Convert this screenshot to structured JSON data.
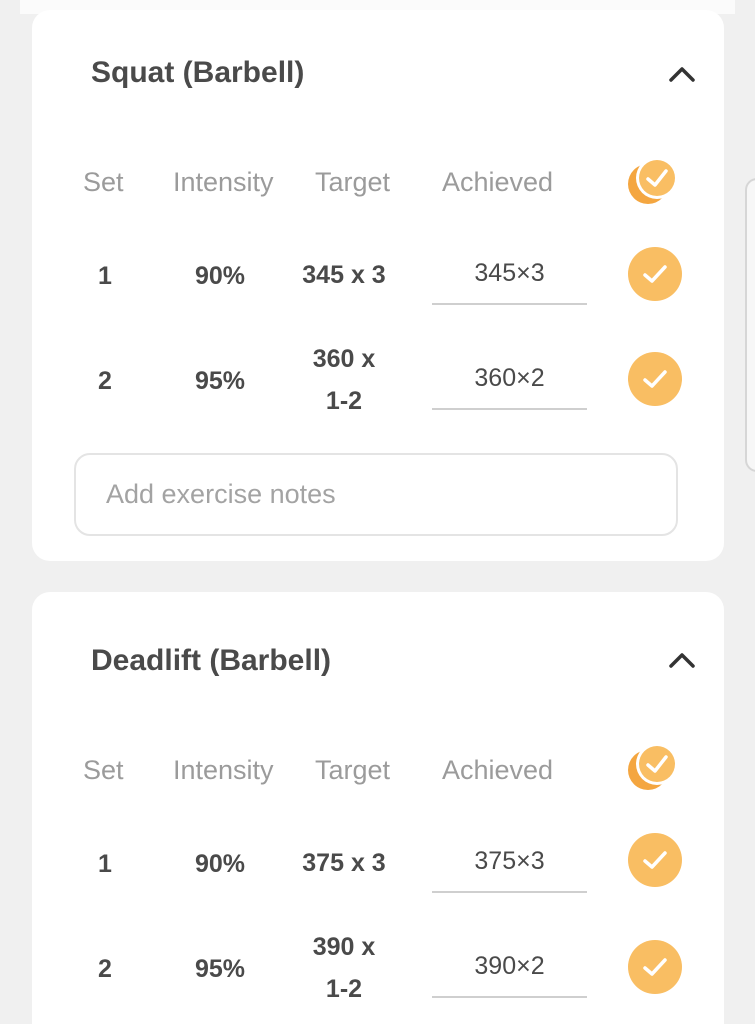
{
  "columns": {
    "set": "Set",
    "intensity": "Intensity",
    "target": "Target",
    "achieved": "Achieved"
  },
  "exercises": [
    {
      "name": "Squat (Barbell)",
      "sets": [
        {
          "set": "1",
          "intensity": "90%",
          "target_line1": "345 x 3",
          "target_line2": "",
          "achieved": "345×3",
          "completed": true
        },
        {
          "set": "2",
          "intensity": "95%",
          "target_line1": "360 x",
          "target_line2": "1-2",
          "achieved": "360×2",
          "completed": true
        }
      ],
      "notes_placeholder": "Add exercise notes"
    },
    {
      "name": "Deadlift (Barbell)",
      "sets": [
        {
          "set": "1",
          "intensity": "90%",
          "target_line1": "375 x 3",
          "target_line2": "",
          "achieved": "375×3",
          "completed": true
        },
        {
          "set": "2",
          "intensity": "95%",
          "target_line1": "390 x",
          "target_line2": "1-2",
          "achieved": "390×2",
          "completed": true
        }
      ]
    }
  ],
  "colors": {
    "accent": "#f9be63",
    "accent_dark": "#f4a640",
    "text": "#4a4a4a",
    "muted": "#9b9b9b"
  },
  "icons": {
    "collapse": "chevron-up-icon",
    "check": "check-icon",
    "check_all": "check-all-icon"
  }
}
